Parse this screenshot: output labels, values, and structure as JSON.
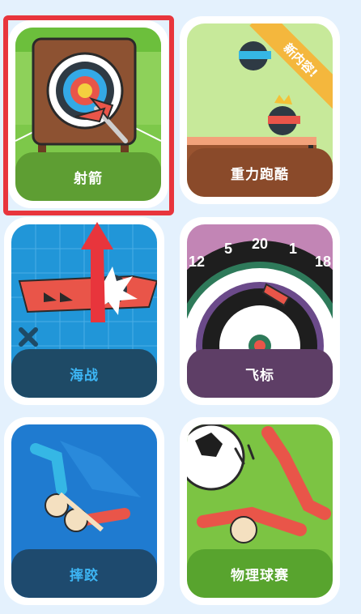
{
  "games": [
    {
      "id": "archery",
      "label": "射箭",
      "bar_color": "#5e9e33"
    },
    {
      "id": "gravity",
      "label": "重力跑酷",
      "bar_color": "#8a4a2a",
      "badge": "新内容!"
    },
    {
      "id": "naval",
      "label": "海战",
      "bar_color": "#1e4a66"
    },
    {
      "id": "darts",
      "label": "飞标",
      "bar_color": "#5e3e66"
    },
    {
      "id": "wrestling",
      "label": "摔跤",
      "bar_color": "#1e4a6e"
    },
    {
      "id": "physics-ball",
      "label": "物理球赛",
      "bar_color": "#58a42e"
    }
  ],
  "dartboard_numbers": [
    "12",
    "5",
    "20",
    "1",
    "18"
  ],
  "highlight_color": "#e8353c"
}
